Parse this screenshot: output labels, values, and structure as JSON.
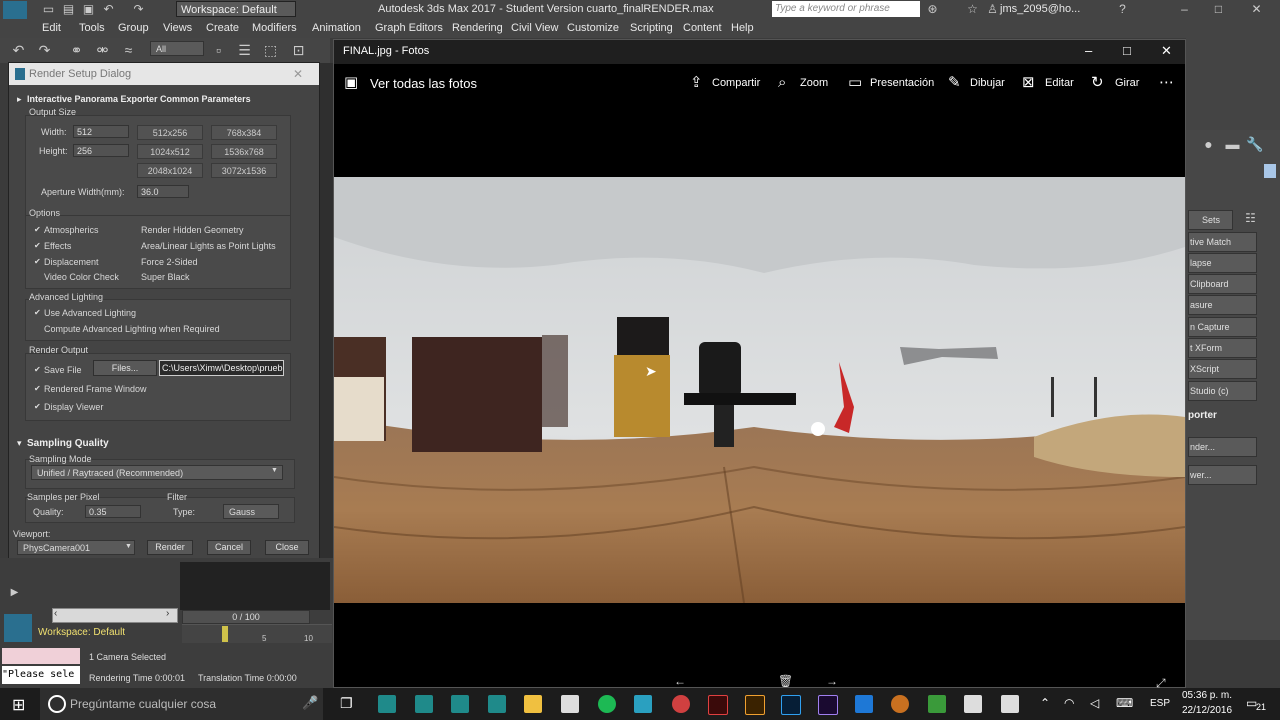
{
  "max": {
    "title": "Autodesk 3ds Max 2017 - Student Version   cuarto_finalRENDER.max",
    "workspace": "Workspace: Default",
    "search_placeholder": "Type a keyword or phrase",
    "user": "jms_2095@ho...",
    "menu": [
      "Edit",
      "Tools",
      "Group",
      "Views",
      "Create",
      "Modifiers",
      "Animation",
      "Graph Editors",
      "Rendering",
      "Civil View",
      "Customize",
      "Scripting",
      "Content",
      "Help"
    ],
    "toolbar_filter": "All",
    "cmd_panel": {
      "sets_label": "Sets",
      "items": [
        "tive Match",
        "lapse",
        "Clipboard",
        "asure",
        "n Capture",
        "t XForm",
        "XScript",
        "Studio (c)"
      ],
      "exporter_label": "porter",
      "exporter_items": [
        "nder...",
        "wer..."
      ]
    },
    "timeline": {
      "frame": "0 / 100",
      "tick5": "5",
      "tick10": "10"
    },
    "status": {
      "workspace": "Workspace: Default",
      "maxscript": "\"Please sele",
      "selected": "1 Camera Selected",
      "render_time": "Rendering Time  0:00:01",
      "translation_time": "Translation Time  0:00:00"
    }
  },
  "render_setup": {
    "title": "Render Setup Dialog",
    "rollout_common": "Interactive Panorama Exporter Common Parameters",
    "output_size": "Output Size",
    "width_label": "Width:",
    "width_value": "512",
    "height_label": "Height:",
    "height_value": "256",
    "presets": [
      "512x256",
      "768x384",
      "1024x512",
      "1536x768",
      "2048x1024",
      "3072x1536"
    ],
    "aperture_label": "Aperture Width(mm):",
    "aperture_value": "36.0",
    "options_label": "Options",
    "options_left": [
      {
        "label": "Atmospherics",
        "checked": true
      },
      {
        "label": "Effects",
        "checked": true
      },
      {
        "label": "Displacement",
        "checked": true
      },
      {
        "label": "Video Color Check",
        "checked": false
      }
    ],
    "options_right": [
      {
        "label": "Render Hidden Geometry",
        "checked": false
      },
      {
        "label": "Area/Linear Lights as Point Lights",
        "checked": false
      },
      {
        "label": "Force 2-Sided",
        "checked": false
      },
      {
        "label": "Super Black",
        "checked": false
      }
    ],
    "advanced_lighting_label": "Advanced Lighting",
    "use_advanced": "Use Advanced Lighting",
    "compute_advanced": "Compute Advanced Lighting when Required",
    "render_output_label": "Render Output",
    "save_file": "Save File",
    "files_button": "Files...",
    "file_path": "C:\\Users\\Ximw\\Desktop\\prueb.jp",
    "rendered_frame_window": "Rendered Frame Window",
    "display_viewer": "Display Viewer",
    "rollout_sampling": "Sampling Quality",
    "sampling_mode_label": "Sampling Mode",
    "sampling_mode_value": "Unified / Raytraced (Recommended)",
    "samples_per_pixel": "Samples per Pixel",
    "quality_label": "Quality:",
    "quality_value": "0.35",
    "filter_label": "Filter",
    "type_label": "Type:",
    "type_value": "Gauss",
    "viewport_label": "Viewport:",
    "viewport_value": "PhysCamera001",
    "render_button": "Render",
    "cancel_button": "Cancel",
    "close_button": "Close"
  },
  "photos": {
    "window_title": "FINAL.jpg - Fotos",
    "view_all": "Ver todas las fotos",
    "actions": [
      "Compartir",
      "Zoom",
      "Presentación",
      "Dibujar",
      "Editar",
      "Girar"
    ]
  },
  "taskbar": {
    "search_placeholder": "Pregúntame cualquier cosa",
    "time": "05:36 p. m.",
    "date": "22/12/2016",
    "language": "ESP",
    "notifications": "21"
  }
}
